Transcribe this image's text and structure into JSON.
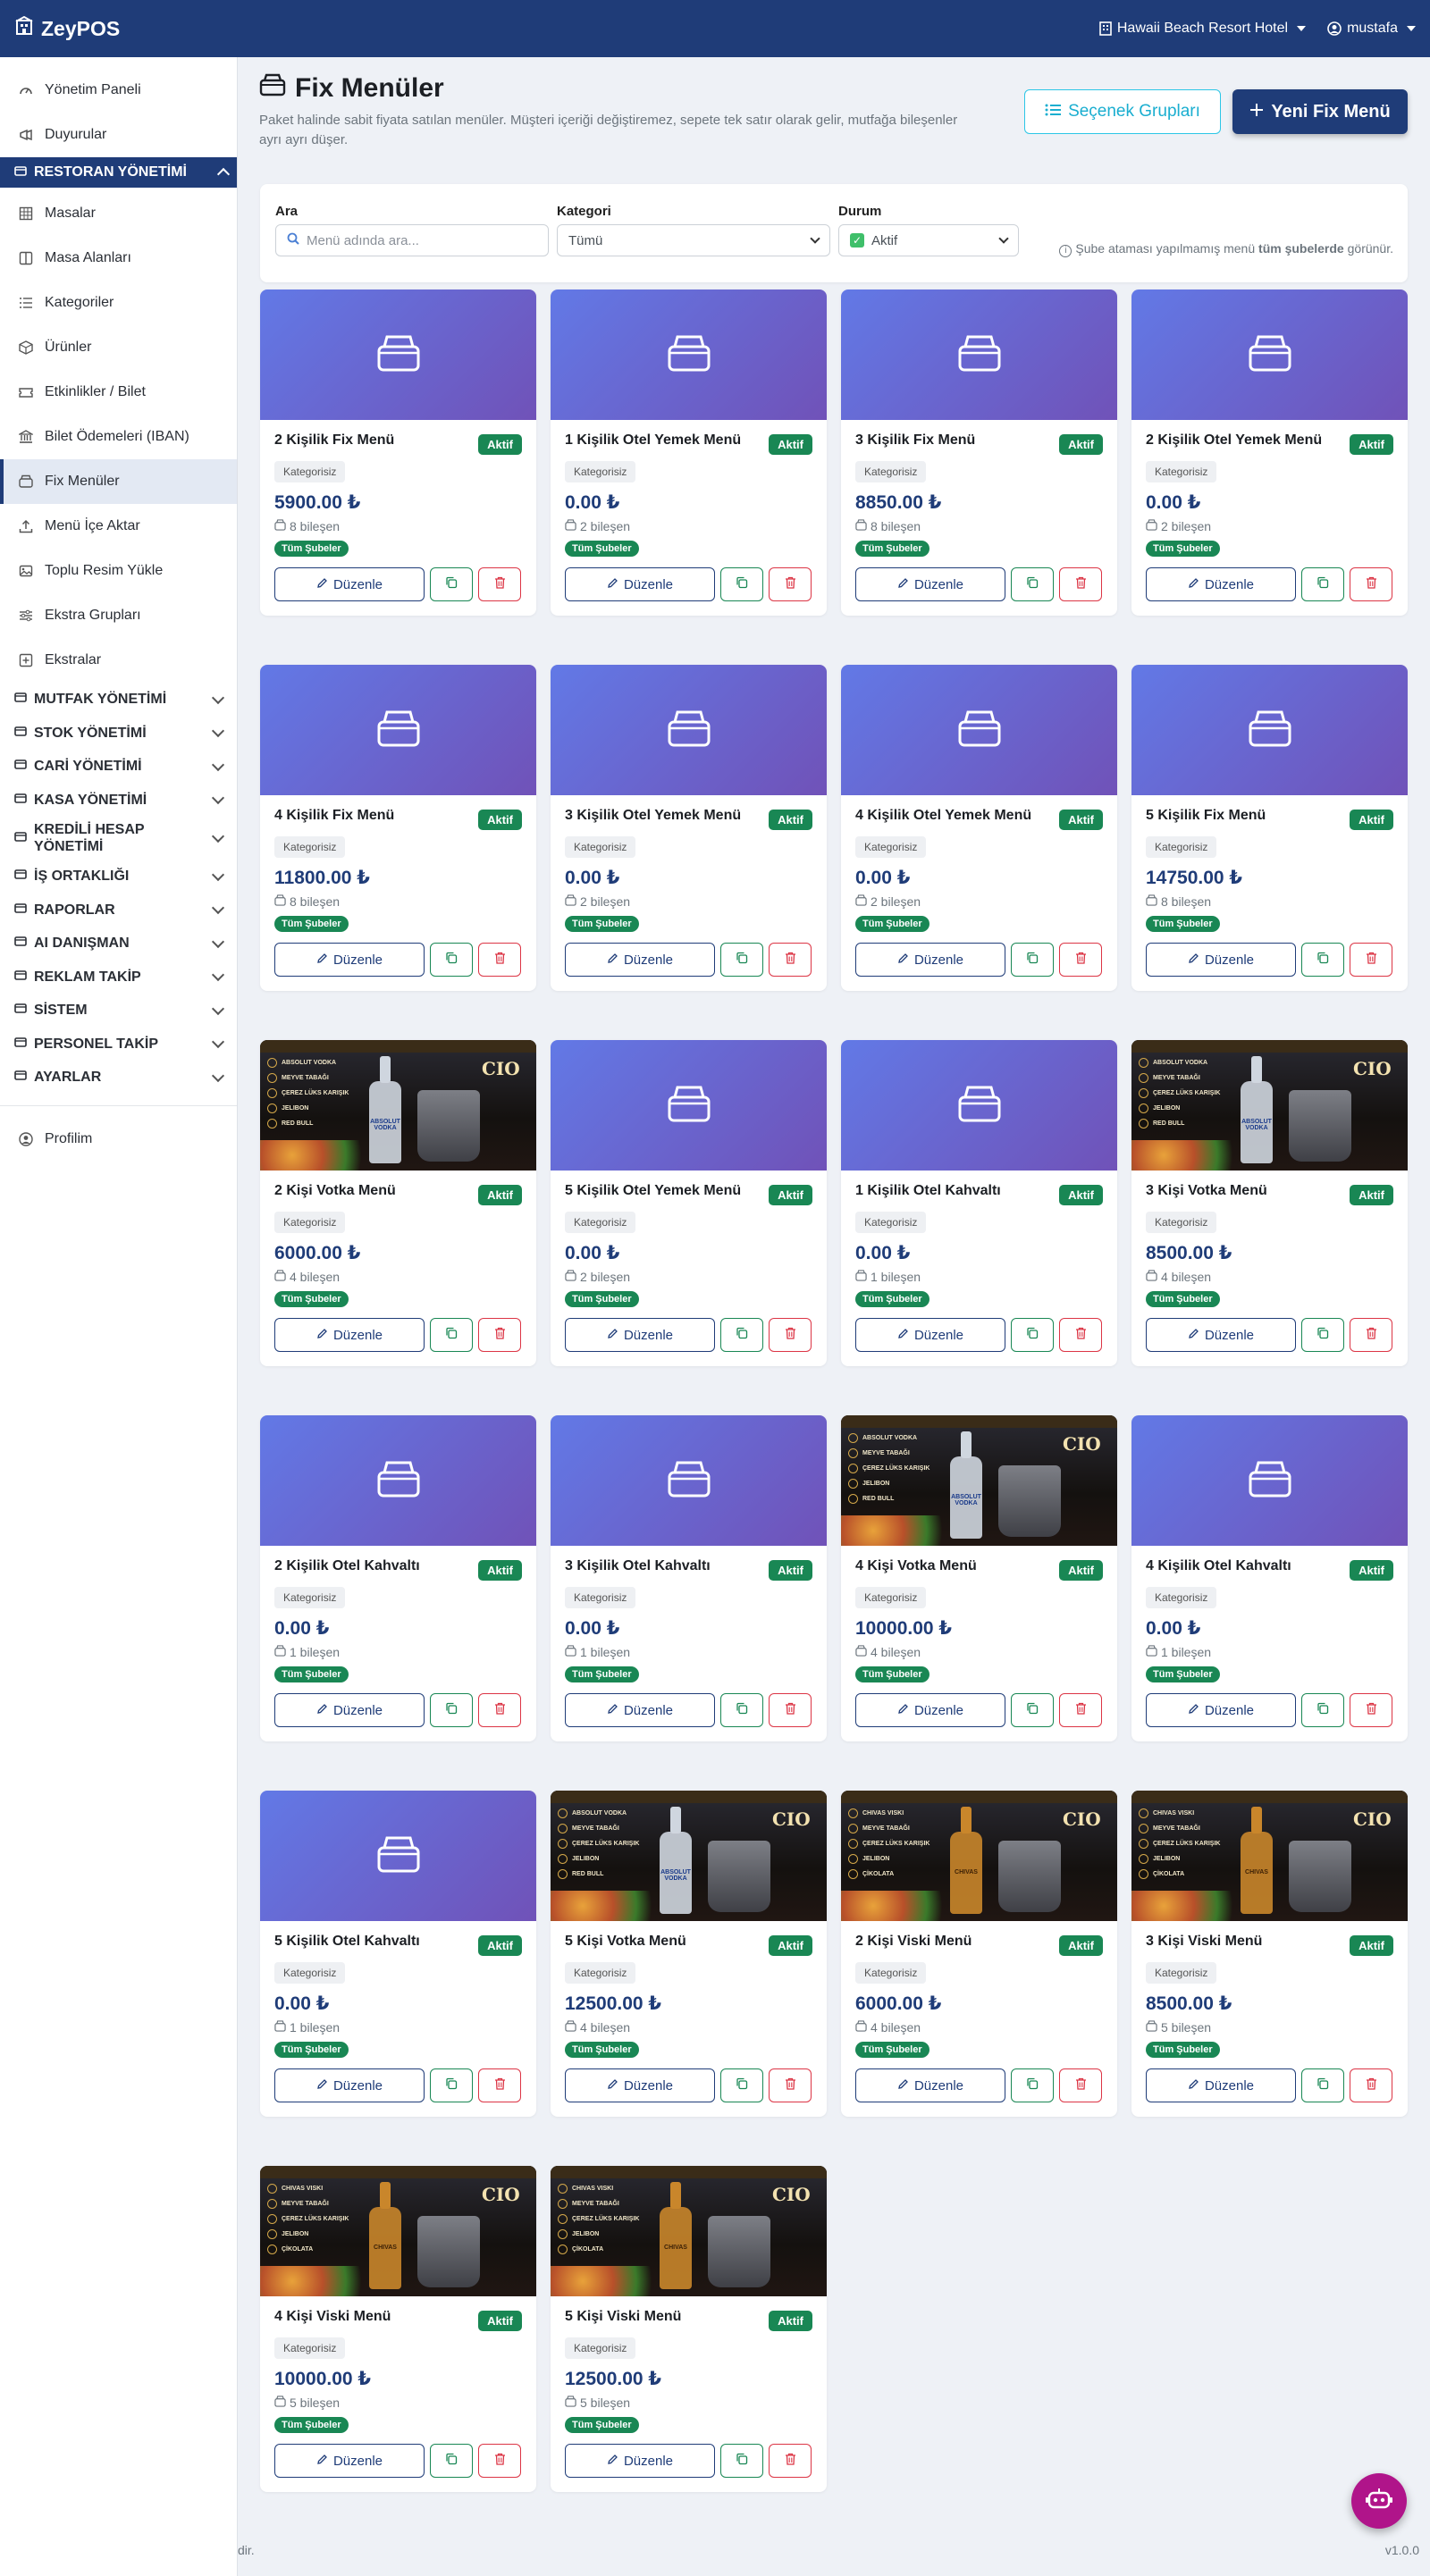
{
  "app": {
    "brand": "ZeyPOS",
    "hotel": "Hawaii Beach Resort Hotel",
    "user": "mustafa"
  },
  "sidebar": {
    "top": [
      {
        "label": "Yönetim Paneli",
        "icon": "gauge-icon"
      },
      {
        "label": "Duyurular",
        "icon": "megaphone-icon"
      }
    ],
    "section": "RESTORAN YÖNETİMİ",
    "items": [
      {
        "label": "Masalar",
        "icon": "table-icon"
      },
      {
        "label": "Masa Alanları",
        "icon": "layout-icon"
      },
      {
        "label": "Kategoriler",
        "icon": "list-icon"
      },
      {
        "label": "Ürünler",
        "icon": "box-icon"
      },
      {
        "label": "Etkinlikler / Bilet",
        "icon": "ticket-icon"
      },
      {
        "label": "Bilet Ödemeleri (IBAN)",
        "icon": "bank-icon"
      },
      {
        "label": "Fix Menüler",
        "icon": "basket-icon",
        "active": true
      },
      {
        "label": "Menü İçe Aktar",
        "icon": "upload-icon"
      },
      {
        "label": "Toplu Resim Yükle",
        "icon": "image-icon"
      },
      {
        "label": "Ekstra Grupları",
        "icon": "sliders-icon"
      },
      {
        "label": "Ekstralar",
        "icon": "plus-square-icon"
      }
    ],
    "groups": [
      {
        "label": "MUTFAK YÖNETİMİ",
        "icon": "fire-icon"
      },
      {
        "label": "STOK YÖNETİMİ",
        "icon": "boxes-icon"
      },
      {
        "label": "CARİ YÖNETİMİ",
        "icon": "wallet-icon"
      },
      {
        "label": "KASA YÖNETİMİ",
        "icon": "cash-icon"
      },
      {
        "label": "KREDİLİ HESAP YÖNETİMİ",
        "icon": "credit-user-icon"
      },
      {
        "label": "İŞ ORTAKLIĞI",
        "icon": "people-icon"
      },
      {
        "label": "RAPORLAR",
        "icon": "chart-icon"
      },
      {
        "label": "AI DANIŞMAN",
        "icon": "robot-icon"
      },
      {
        "label": "REKLAM TAKİP",
        "icon": "megaphone-icon"
      },
      {
        "label": "SİSTEM",
        "icon": "gear-icon"
      },
      {
        "label": "PERSONEL TAKİP",
        "icon": "person-badge-icon"
      },
      {
        "label": "AYARLAR",
        "icon": "gear-icon"
      }
    ],
    "profile": "Profilim"
  },
  "page": {
    "title": "Fix Menüler",
    "subtitle": "Paket halinde sabit fiyata satılan menüler. Müşteri içeriği değiştiremez, sepete tek satır olarak gelir, mutfağa bileşenler ayrı ayrı düşer.",
    "btn_groups": "Seçenek Grupları",
    "btn_new": "Yeni Fix Menü"
  },
  "filters": {
    "search_label": "Ara",
    "search_placeholder": "Menü adında ara...",
    "category_label": "Kategori",
    "category_value": "Tümü",
    "status_label": "Durum",
    "status_value": "Aktif",
    "note_prefix": "Şube ataması yapılmamış menü ",
    "note_bold": "tüm şubelerde",
    "note_suffix": " görünür."
  },
  "card_labels": {
    "status": "Aktif",
    "category": "Kategorisiz",
    "branch": "Tüm Şubeler",
    "edit": "Düzenle"
  },
  "menus": [
    {
      "name": "2 Kişilik Fix Menü",
      "price": "5900.00 ₺",
      "components": "8 bileşen",
      "image": "placeholder"
    },
    {
      "name": "1 Kişilik Otel Yemek Menü",
      "price": "0.00 ₺",
      "components": "2 bileşen",
      "image": "placeholder"
    },
    {
      "name": "3 Kişilik Fix Menü",
      "price": "8850.00 ₺",
      "components": "8 bileşen",
      "image": "placeholder"
    },
    {
      "name": "2 Kişilik Otel Yemek Menü",
      "price": "0.00 ₺",
      "components": "2 bileşen",
      "image": "placeholder"
    },
    {
      "name": "4 Kişilik Fix Menü",
      "price": "11800.00 ₺",
      "components": "8 bileşen",
      "image": "placeholder"
    },
    {
      "name": "3 Kişilik Otel Yemek Menü",
      "price": "0.00 ₺",
      "components": "2 bileşen",
      "image": "placeholder"
    },
    {
      "name": "4 Kişilik Otel Yemek Menü",
      "price": "0.00 ₺",
      "components": "2 bileşen",
      "image": "placeholder"
    },
    {
      "name": "5 Kişilik Fix Menü",
      "price": "14750.00 ₺",
      "components": "8 bileşen",
      "image": "placeholder"
    },
    {
      "name": "2 Kişi Votka Menü",
      "price": "6000.00 ₺",
      "components": "4 bileşen",
      "image": "vodka"
    },
    {
      "name": "5 Kişilik Otel Yemek Menü",
      "price": "0.00 ₺",
      "components": "2 bileşen",
      "image": "placeholder"
    },
    {
      "name": "1 Kişilik Otel Kahvaltı",
      "price": "0.00 ₺",
      "components": "1 bileşen",
      "image": "placeholder"
    },
    {
      "name": "3 Kişi Votka Menü",
      "price": "8500.00 ₺",
      "components": "4 bileşen",
      "image": "vodka"
    },
    {
      "name": "2 Kişilik Otel Kahvaltı",
      "price": "0.00 ₺",
      "components": "1 bileşen",
      "image": "placeholder"
    },
    {
      "name": "3 Kişilik Otel Kahvaltı",
      "price": "0.00 ₺",
      "components": "1 bileşen",
      "image": "placeholder"
    },
    {
      "name": "4 Kişi Votka Menü",
      "price": "10000.00 ₺",
      "components": "4 bileşen",
      "image": "vodka"
    },
    {
      "name": "4 Kişilik Otel Kahvaltı",
      "price": "0.00 ₺",
      "components": "1 bileşen",
      "image": "placeholder"
    },
    {
      "name": "5 Kişilik Otel Kahvaltı",
      "price": "0.00 ₺",
      "components": "1 bileşen",
      "image": "placeholder"
    },
    {
      "name": "5 Kişi Votka Menü",
      "price": "12500.00 ₺",
      "components": "4 bileşen",
      "image": "vodka"
    },
    {
      "name": "2 Kişi Viski Menü",
      "price": "6000.00 ₺",
      "components": "4 bileşen",
      "image": "whisky"
    },
    {
      "name": "3 Kişi Viski Menü",
      "price": "8500.00 ₺",
      "components": "5 bileşen",
      "image": "whisky"
    },
    {
      "name": "4 Kişi Viski Menü",
      "price": "10000.00 ₺",
      "components": "5 bileşen",
      "image": "whisky"
    },
    {
      "name": "5 Kişi Viski Menü",
      "price": "12500.00 ₺",
      "components": "5 bileşen",
      "image": "whisky"
    }
  ],
  "photo_text": {
    "vodka": {
      "items": [
        "ABSOLUT VODKA",
        "MEYVE TABAĞI",
        "ÇEREZ LÜKS KARIŞIK",
        "JELIBON",
        "RED BULL"
      ],
      "brand": "CIO",
      "bottle": "ABSOLUT VODKA"
    },
    "whisky": {
      "items": [
        "CHIVAS VISKI",
        "MEYVE TABAĞI",
        "ÇEREZ LÜKS KARIŞIK",
        "JELIBON",
        "ÇİKOLATA"
      ],
      "brand": "CIO",
      "bottle": "CHIVAS"
    }
  },
  "footer": {
    "left": "dir.",
    "version": "v1.0.0"
  },
  "colors": {
    "primary": "#1f3c78",
    "success": "#198754",
    "danger": "#dc3545",
    "info": "#2cc6e6",
    "fab": "#b0148a"
  }
}
